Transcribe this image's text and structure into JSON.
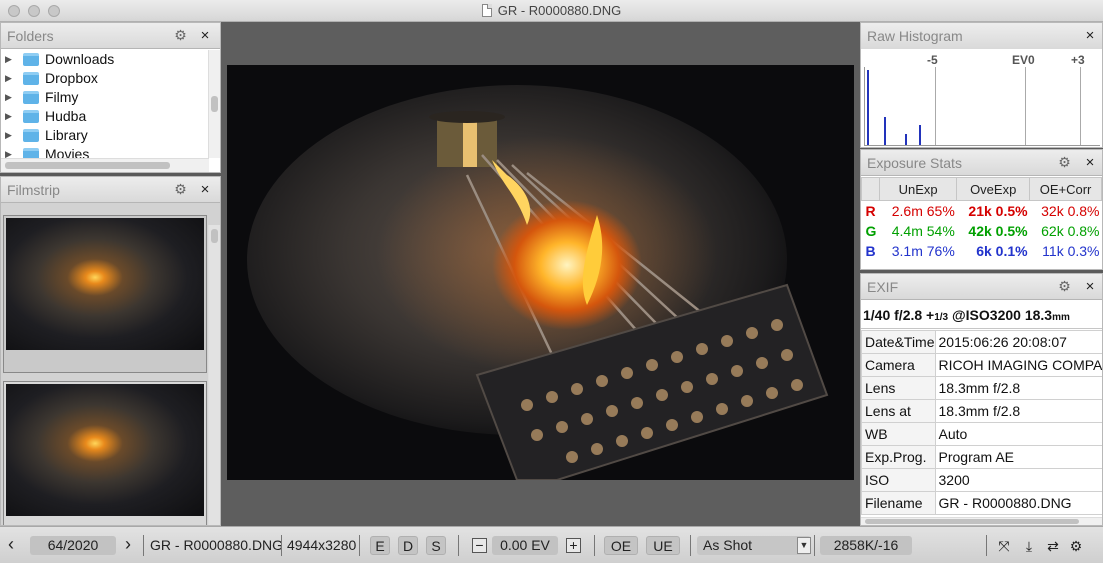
{
  "window": {
    "title": "GR - R0000880.DNG"
  },
  "folders": {
    "title": "Folders",
    "items": [
      {
        "label": "Downloads"
      },
      {
        "label": "Dropbox"
      },
      {
        "label": "Filmy"
      },
      {
        "label": "Hudba"
      },
      {
        "label": "Library"
      },
      {
        "label": "Movies"
      }
    ]
  },
  "filmstrip": {
    "title": "Filmstrip"
  },
  "histogram": {
    "title": "Raw Histogram",
    "labels": [
      "-5",
      "EV0",
      "+3"
    ]
  },
  "exposure_stats": {
    "title": "Exposure Stats",
    "headers": [
      "UnExp",
      "OveExp",
      "OE+Corr"
    ],
    "rows": [
      {
        "ch": "R",
        "unexp": "2.6m 65%",
        "oveexp": "21k 0.5%",
        "oecorr": "32k 0.8%"
      },
      {
        "ch": "G",
        "unexp": "4.4m 54%",
        "oveexp": "42k 0.5%",
        "oecorr": "62k 0.8%"
      },
      {
        "ch": "B",
        "unexp": "3.1m 76%",
        "oveexp": "6k 0.1%",
        "oecorr": "11k 0.3%"
      }
    ],
    "colors": {
      "R": "#d50000",
      "G": "#00a000",
      "B": "#2233cc"
    }
  },
  "exif": {
    "title": "EXIF",
    "summary": {
      "main": "1/40 f/2.8 +",
      "ev": "1/3",
      "iso": " @ISO3200 18.3",
      "unit": "mm"
    },
    "rows": [
      {
        "key": "Date&Time",
        "value": "2015:06:26 20:08:07"
      },
      {
        "key": "Camera",
        "value": "RICOH IMAGING COMPANY"
      },
      {
        "key": "Lens",
        "value": "18.3mm f/2.8"
      },
      {
        "key": "Lens at",
        "value": "18.3mm f/2.8"
      },
      {
        "key": "WB",
        "value": "Auto"
      },
      {
        "key": "Exp.Prog.",
        "value": "Program AE"
      },
      {
        "key": "ISO",
        "value": "3200"
      },
      {
        "key": "Filename",
        "value": "GR - R0000880.DNG"
      }
    ]
  },
  "toolbar": {
    "prev": "‹",
    "counter": "64/2020",
    "next": "›",
    "filename": "GR - R0000880.DNG",
    "dimensions": "4944x3280",
    "btn_e": "E",
    "btn_d": "D",
    "btn_s": "S",
    "minus": "−",
    "ev_value": "0.00 EV",
    "plus": "+",
    "btn_oe": "OE",
    "btn_ue": "UE",
    "wb_select": "As Shot",
    "raw_value": "2858K/-16"
  }
}
